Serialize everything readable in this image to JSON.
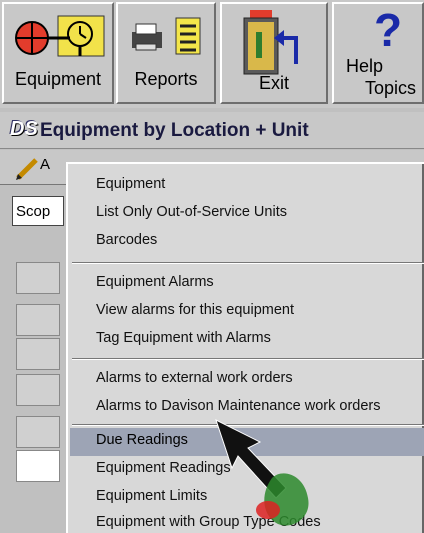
{
  "toolbar": {
    "equipment_label": "Equipment",
    "reports_label": "Reports",
    "exit_label": "Exit",
    "help_label_line1": "Help",
    "help_label_line2": "Topics"
  },
  "window": {
    "logo": "DS",
    "title": "Equipment by Location + Unit"
  },
  "grid": {
    "header_label": "Scop",
    "subbar_label": "A"
  },
  "menu": {
    "items": [
      "Equipment",
      "List Only Out-of-Service Units",
      "Barcodes",
      "Equipment Alarms",
      "View alarms for this equipment",
      "Tag Equipment with Alarms",
      "Alarms to external work orders",
      "Alarms to Davison Maintenance work orders",
      "Due Readings",
      "Equipment Readings",
      "Equipment Limits",
      "Equipment with Group Type Codes"
    ],
    "highlighted": "Due Readings"
  },
  "colors": {
    "highlight": "#9da4b5",
    "menu_bg": "#d8d8d8",
    "help_icon": "#1a2aa8"
  }
}
